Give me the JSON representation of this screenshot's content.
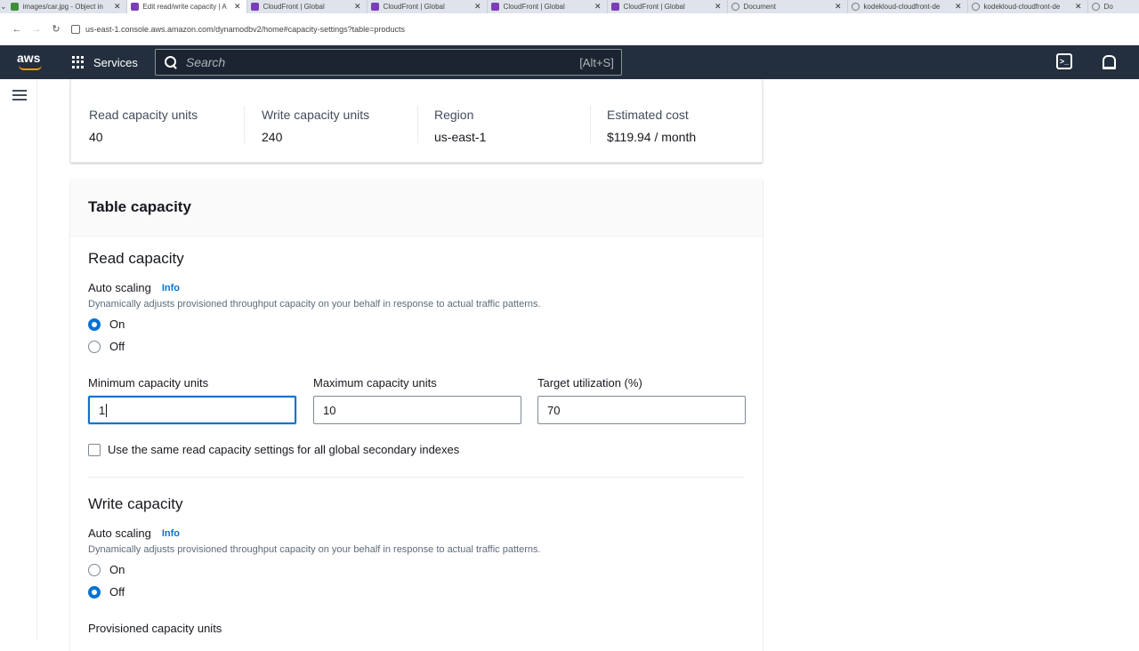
{
  "browser": {
    "tabs": [
      {
        "title": "images/car.jpg - Object in",
        "icon": "green",
        "active": false
      },
      {
        "title": "Edit read/write capacity | A",
        "icon": "purple",
        "active": true
      },
      {
        "title": "CloudFront | Global",
        "icon": "purple",
        "active": false
      },
      {
        "title": "CloudFront | Global",
        "icon": "purple",
        "active": false
      },
      {
        "title": "CloudFront | Global",
        "icon": "purple",
        "active": false
      },
      {
        "title": "CloudFront | Global",
        "icon": "purple",
        "active": false
      },
      {
        "title": "Document",
        "icon": "globe",
        "active": false
      },
      {
        "title": "kodekloud-cloudfront-de",
        "icon": "globe",
        "active": false
      },
      {
        "title": "kodekloud-cloudfront-de",
        "icon": "globe",
        "active": false
      },
      {
        "title": "Do",
        "icon": "globe",
        "active": false
      }
    ],
    "url": "us-east-1.console.aws.amazon.com/dynamodbv2/home#capacity-settings?table=products"
  },
  "awsnav": {
    "logo_text": "aws",
    "services_label": "Services",
    "search_placeholder": "Search",
    "search_shortcut": "[Alt+S]"
  },
  "summary": {
    "read_capacity_label": "Read capacity units",
    "read_capacity_value": "40",
    "write_capacity_label": "Write capacity units",
    "write_capacity_value": "240",
    "region_label": "Region",
    "region_value": "us-east-1",
    "cost_label": "Estimated cost",
    "cost_value": "$119.94 / month"
  },
  "table_capacity": {
    "title": "Table capacity",
    "read": {
      "title": "Read capacity",
      "auto_scaling_label": "Auto scaling",
      "info_label": "Info",
      "description": "Dynamically adjusts provisioned throughput capacity on your behalf in response to actual traffic patterns.",
      "on_label": "On",
      "off_label": "Off",
      "selected": "On",
      "min_label": "Minimum capacity units",
      "min_value": "1",
      "max_label": "Maximum capacity units",
      "max_value": "10",
      "target_label": "Target utilization (%)",
      "target_value": "70",
      "gsi_checkbox_label": "Use the same read capacity settings for all global secondary indexes",
      "gsi_checked": false
    },
    "write": {
      "title": "Write capacity",
      "auto_scaling_label": "Auto scaling",
      "info_label": "Info",
      "description": "Dynamically adjusts provisioned throughput capacity on your behalf in response to actual traffic patterns.",
      "on_label": "On",
      "off_label": "Off",
      "selected": "Off",
      "provisioned_label": "Provisioned capacity units"
    }
  }
}
